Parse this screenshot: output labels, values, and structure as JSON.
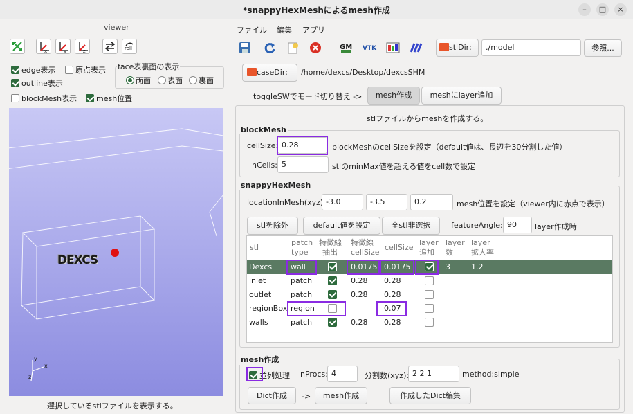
{
  "window": {
    "title": "*snappyHexMeshによるmesh作成",
    "minimize": "–",
    "maximize": "□",
    "close": "×"
  },
  "viewer": {
    "title": "viewer",
    "edge_label": "edge表示",
    "edge_checked": true,
    "origin_label": "原点表示",
    "origin_checked": false,
    "outline_label": "outline表示",
    "outline_checked": true,
    "face_group_title": "face表裏面の表示",
    "face_options": [
      "両面",
      "表面",
      "裏面"
    ],
    "face_selected": "両面",
    "blockmesh_label": "blockMesh表示",
    "blockmesh_checked": false,
    "meshpos_label": "mesh位置",
    "meshpos_checked": true,
    "toolbar_icons": [
      "fit-icon",
      "view-x-icon",
      "view-y-icon",
      "view-z-icon",
      "reverse-icon",
      "roll-icon"
    ],
    "roll_label": "roll",
    "model_text": "DEXCS",
    "axis_y": "y",
    "axis_x": "x",
    "axis_z": "z",
    "status": "選択しているstlファイルを表示する。"
  },
  "menu": {
    "file": "ファイル",
    "edit": "編集",
    "app": "アプリ"
  },
  "toolbar": {
    "icons": [
      "save-icon",
      "reload-icon",
      "new-icon",
      "stop-icon",
      "gm-icon",
      "vtk-icon",
      "paraview-icon",
      "paint-icon"
    ],
    "stldir_label": "stlDir:",
    "stldir_value": "./model",
    "browse": "参照...",
    "casedir_label": "caseDir:",
    "casedir_value": "/home/dexcs/Desktop/dexcsSHM"
  },
  "mode": {
    "toggle_text": "toggleSWでモード切り替え ->",
    "tab_mesh": "mesh作成",
    "tab_layer": "meshにlayer追加"
  },
  "main": {
    "heading": "stlファイルからmeshを作成する。",
    "blockmesh": {
      "title": "blockMesh",
      "cellsize_label": "cellSize:",
      "cellsize_value": "0.28",
      "cellsize_note": "blockMeshのcellSizeを設定（default値は、長辺を30分割した値）",
      "ncells_label": "nCells:",
      "ncells_value": "5",
      "ncells_note": "stlのminMax値を超える値をcell数で設定"
    },
    "snappy": {
      "title": "snappyHexMesh",
      "location_label": "locationInMesh(xyz):",
      "location_x": "-3.0",
      "location_y": "-3.5",
      "location_z": "0.2",
      "location_note": "mesh位置を設定（viewer内に赤点で表示）",
      "remove_stl": "stlを除外",
      "set_default": "default値を設定",
      "deselect_all": "全stl非選択",
      "feature_angle_label": "featureAngle:",
      "feature_angle_value": "90",
      "layer_note": "layer作成時",
      "headers": {
        "stl": "stl",
        "patch1": "patch",
        "patch2": "type",
        "feat1": "特徴線",
        "feat2": "抽出",
        "fcell1": "特徴線",
        "fcell2": "cellSize",
        "cellsize": "cellSize",
        "ladd1": "layer",
        "ladd2": "追加",
        "lnum1": "layer",
        "lnum2": "数",
        "lrate1": "layer",
        "lrate2": "拡大率"
      },
      "rows": [
        {
          "stl": "Dexcs",
          "type": "wall",
          "feature": true,
          "feature_cellsize": "0.0175",
          "cellsize": "0.0175",
          "layer": true,
          "layer_num": "3",
          "layer_rate": "1.2",
          "selected": true
        },
        {
          "stl": "inlet",
          "type": "patch",
          "feature": true,
          "feature_cellsize": "0.28",
          "cellsize": "0.28",
          "layer": false,
          "layer_num": "",
          "layer_rate": ""
        },
        {
          "stl": "outlet",
          "type": "patch",
          "feature": true,
          "feature_cellsize": "0.28",
          "cellsize": "0.28",
          "layer": false,
          "layer_num": "",
          "layer_rate": ""
        },
        {
          "stl": "regionBox",
          "type": "region",
          "feature": false,
          "feature_cellsize": "",
          "cellsize": "0.07",
          "layer": false,
          "layer_num": "",
          "layer_rate": ""
        },
        {
          "stl": "walls",
          "type": "patch",
          "feature": true,
          "feature_cellsize": "0.28",
          "cellsize": "0.28",
          "layer": false,
          "layer_num": "",
          "layer_rate": ""
        }
      ]
    },
    "meshmake": {
      "title": "mesh作成",
      "parallel_label": "並列処理",
      "parallel_checked": true,
      "nprocs_label": "nProcs:",
      "nprocs_value": "4",
      "div_label": "分割数(xyz):",
      "div_value": "2 2 1",
      "method": "method:simple",
      "dict_btn": "Dict作成",
      "arrow": "->",
      "mesh_btn": "mesh作成",
      "edit_btn": "作成したDict編集"
    }
  },
  "colors": {
    "highlight": "#8a2be2",
    "selected_row": "#5a7a62",
    "check_green": "#2e6b3d",
    "viewer_top": "#c8c8f5",
    "viewer_bottom": "#8c8ce0"
  }
}
